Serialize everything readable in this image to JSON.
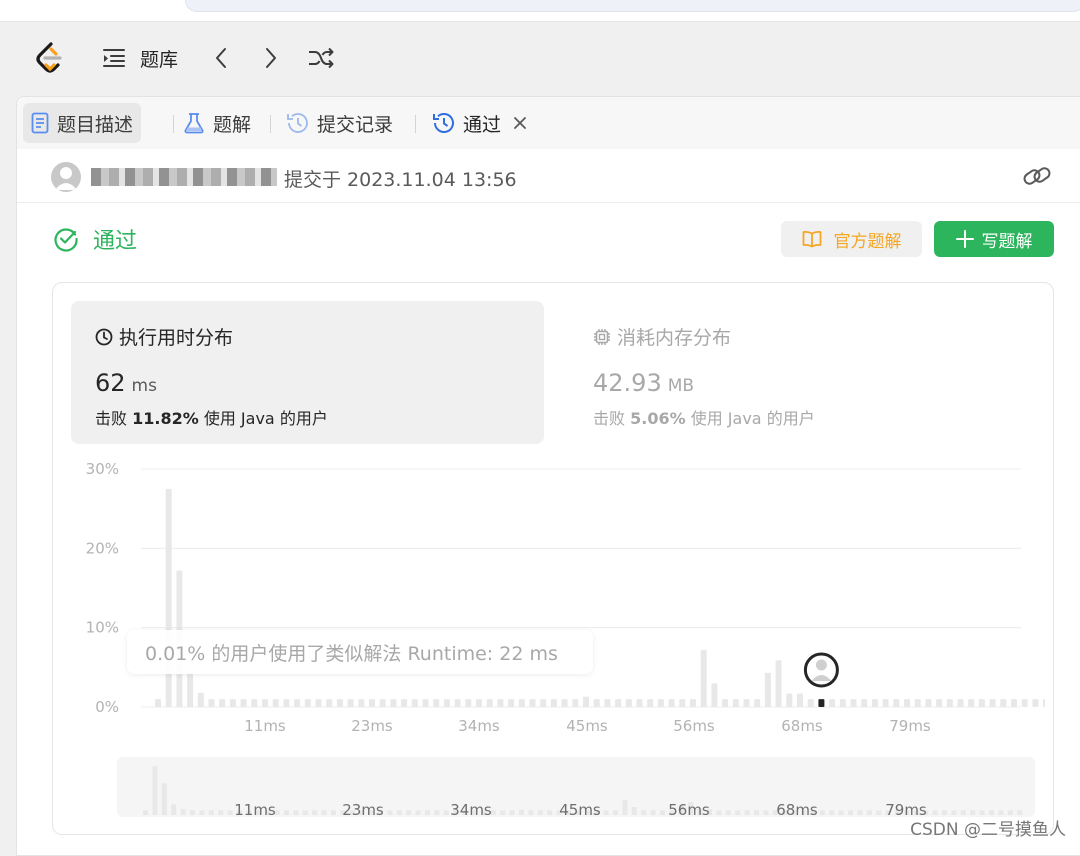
{
  "nav": {
    "problem_bank": "题库"
  },
  "tabs": {
    "description": "题目描述",
    "solutions": "题解",
    "submissions": "提交记录",
    "accepted": "通过"
  },
  "submission": {
    "submitted_at": "提交于 2023.11.04 13:56"
  },
  "status": {
    "label": "通过",
    "official_solution": "官方题解",
    "write_solution": "写题解"
  },
  "runtime": {
    "title": "执行用时分布",
    "value": "62",
    "unit": "ms",
    "beat_prefix": "击败",
    "beat_pct": "11.82%",
    "beat_suffix": "使用 Java 的用户"
  },
  "memory": {
    "title": "消耗内存分布",
    "value": "42.93",
    "unit": "MB",
    "beat_prefix": "击败",
    "beat_pct": "5.06%",
    "beat_suffix": "使用 Java 的用户"
  },
  "tooltip": "0.01% 的用户使用了类似解法 Runtime: 22 ms",
  "watermark": "CSDN @二号摸鱼人",
  "colors": {
    "accent_green": "#2db55d",
    "official_orange": "#f5a623",
    "bar_gray": "#e8e8e8",
    "grid": "#ececec"
  },
  "chart_data": {
    "type": "bar",
    "ylabel": "",
    "xlabel": "",
    "y_ticks": [
      "0%",
      "10%",
      "20%",
      "30%"
    ],
    "ylim": [
      0,
      30
    ],
    "x_ticks": [
      "11ms",
      "23ms",
      "34ms",
      "45ms",
      "56ms",
      "68ms",
      "79ms"
    ],
    "grid": true,
    "overview_ticks": [
      "11ms",
      "23ms",
      "34ms",
      "45ms",
      "56ms",
      "68ms",
      "79ms"
    ],
    "values": [
      1,
      27.5,
      17.2,
      4.6,
      1.8,
      1,
      1,
      1,
      1,
      1,
      1,
      1,
      1,
      1,
      1,
      1,
      1,
      1,
      1,
      1,
      1,
      1,
      1,
      1,
      1,
      1,
      1,
      1,
      1,
      1,
      1,
      1,
      1,
      1,
      1,
      1,
      1,
      1,
      1,
      1,
      1.3,
      1,
      1,
      1,
      1,
      1,
      1,
      1,
      1,
      1,
      1,
      7.2,
      3,
      1,
      1,
      1,
      1,
      4.3,
      5.9,
      1.7,
      1.7,
      1,
      1,
      1,
      1,
      1,
      1,
      1,
      1,
      1,
      1,
      1,
      1,
      1,
      1,
      1,
      1,
      1,
      1,
      1,
      1,
      1,
      1,
      1,
      1,
      1,
      1,
      1,
      1,
      1,
      1,
      1,
      1,
      1
    ],
    "current_index": 62
  }
}
